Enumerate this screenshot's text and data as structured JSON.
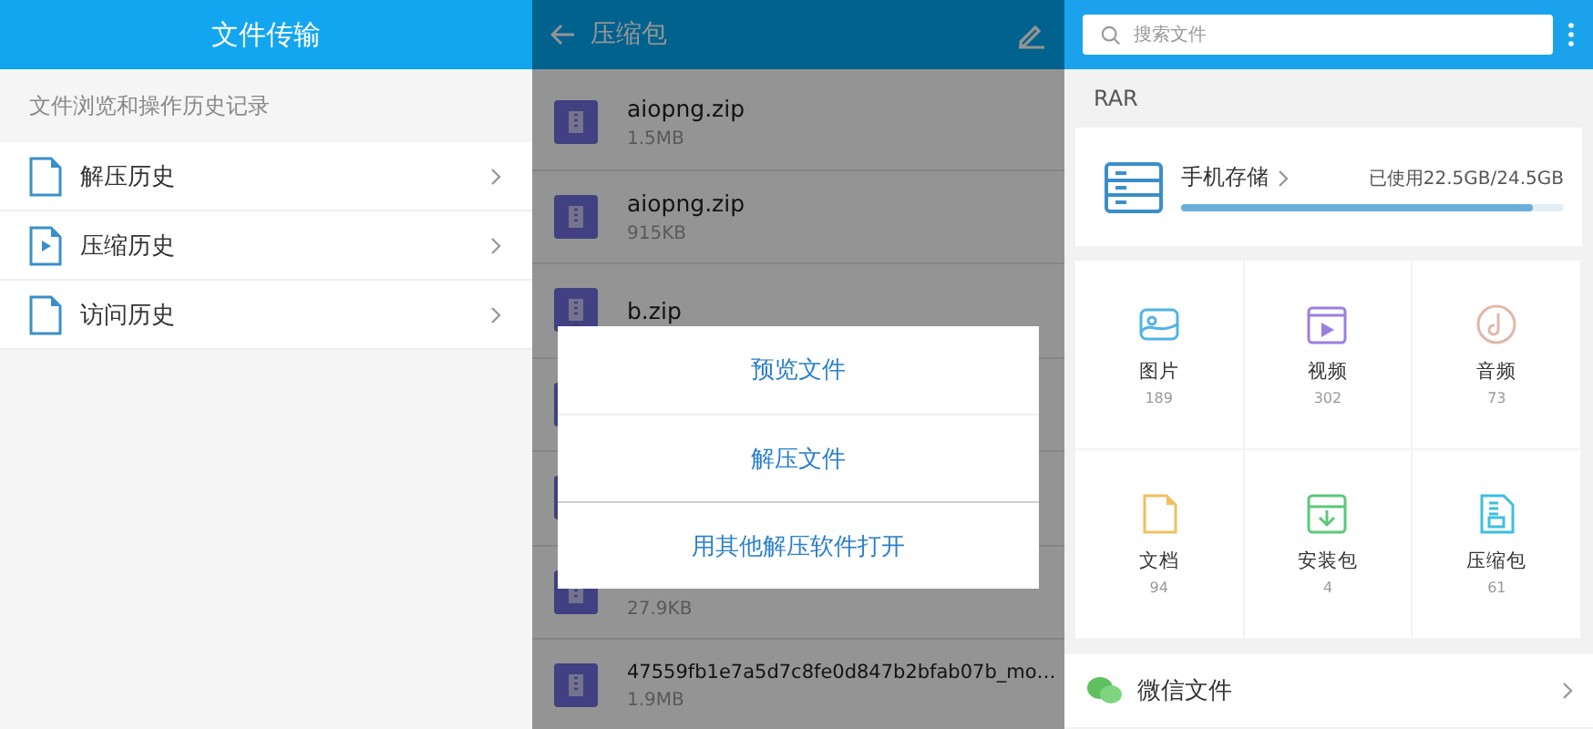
{
  "left_panel": {
    "title": "文件传输",
    "subtitle": "文件浏览和操作历史记录",
    "items": [
      {
        "label": "解压历史",
        "kind": "doc"
      },
      {
        "label": "压缩历史",
        "kind": "video"
      },
      {
        "label": "访问历史",
        "kind": "doc"
      }
    ]
  },
  "middle_panel": {
    "title": "压缩包",
    "files": [
      {
        "kind": "zip",
        "name": "aiopng.zip",
        "size": "1.5MB"
      },
      {
        "kind": "zip",
        "name": "aiopng.zip",
        "size": "915KB"
      },
      {
        "kind": "zip",
        "name": "b.zip"
      },
      {
        "kind": "zip"
      },
      {
        "kind": "zip"
      },
      {
        "kind": "zip",
        "size": "27.9KB"
      },
      {
        "kind": "zip",
        "name": "47559fb1e7a5d7c8fe0d847b2bfab07b_mo…",
        "size": "1.9MB"
      }
    ],
    "dialog": {
      "options": [
        "预览文件",
        "解压文件",
        "用其他解压软件打开"
      ]
    }
  },
  "right_panel": {
    "search": {
      "placeholder": "搜索文件"
    },
    "section_label": "RAR",
    "storage": {
      "name": "手机存储",
      "usage": "已使用22.5GB/24.5GB",
      "level": 0.92
    },
    "categories": [
      {
        "label": "图片",
        "count": "189",
        "kind": "image",
        "color": "#4fb3e8"
      },
      {
        "label": "视频",
        "count": "302",
        "kind": "video",
        "color": "#9b7fe0"
      },
      {
        "label": "音频",
        "count": "73",
        "kind": "audio",
        "color": "#e0b8a8"
      },
      {
        "label": "文档",
        "count": "94",
        "kind": "doc",
        "color": "#f0c060"
      },
      {
        "label": "安装包",
        "count": "4",
        "kind": "apk",
        "color": "#5cc87a"
      },
      {
        "label": "压缩包",
        "count": "61",
        "kind": "zip",
        "color": "#3cbfe0"
      }
    ],
    "wechat": {
      "label": "微信文件"
    }
  }
}
